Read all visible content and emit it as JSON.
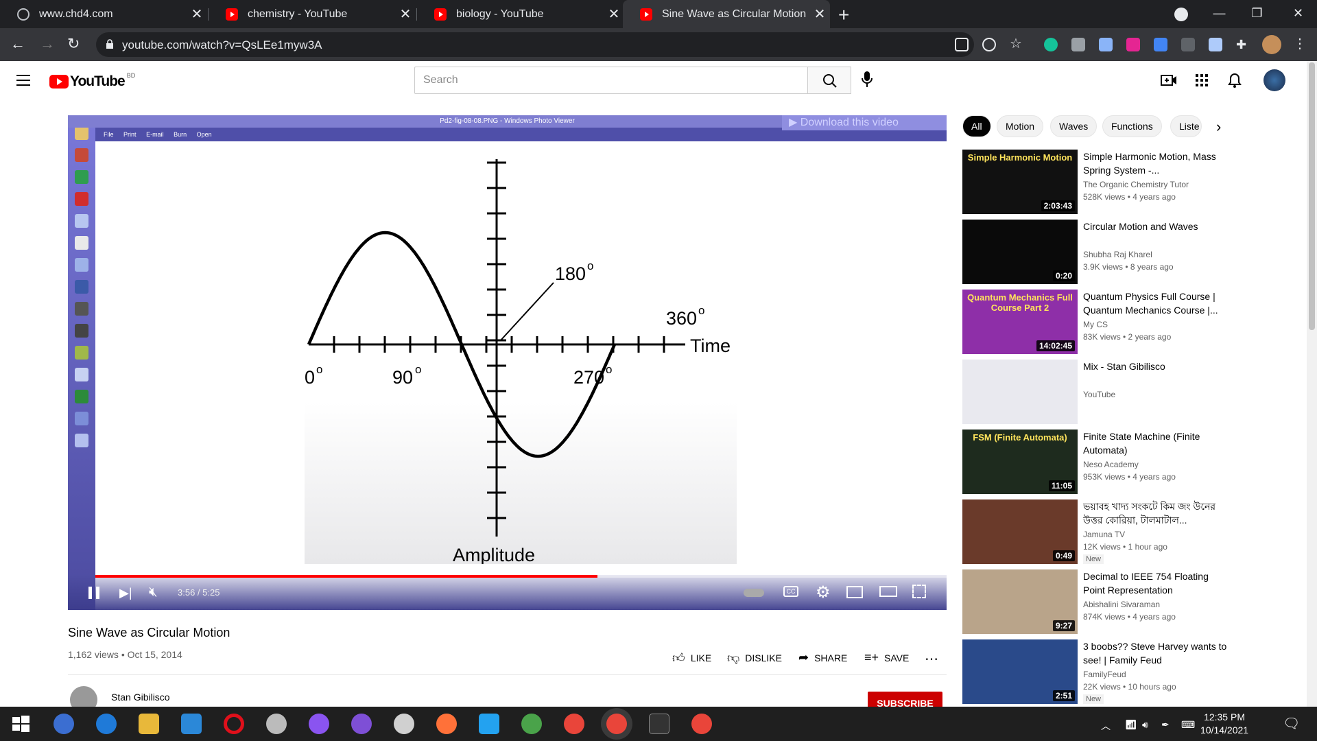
{
  "browser": {
    "tabs": [
      {
        "title": "www.chd4.com"
      },
      {
        "title": "chemistry - YouTube"
      },
      {
        "title": "biology - YouTube"
      },
      {
        "title": "Sine Wave as Circular Motion - Yo"
      }
    ],
    "url": "youtube.com/watch?v=QsLEe1myw3A"
  },
  "youtube": {
    "country": "BD",
    "search_placeholder": "Search"
  },
  "player": {
    "photo_viewer_title": "Pd2-fig-08-08.PNG - Windows Photo Viewer",
    "menu": [
      "File",
      "Print",
      "E-mail",
      "Burn",
      "Open"
    ],
    "download_banner": "Download this video",
    "time": "3:56 / 5:25",
    "progress": 0.59,
    "figure": {
      "labels": {
        "deg0": "0",
        "deg90": "90",
        "deg180": "180",
        "deg270": "270",
        "deg360": "360",
        "deg_sup": "o",
        "time": "Time",
        "amplitude": "Amplitude"
      }
    }
  },
  "video": {
    "title": "Sine Wave as Circular Motion",
    "meta": "1,162 views • Oct 15, 2014",
    "like": "LIKE",
    "dislike": "DISLIKE",
    "share": "SHARE",
    "save": "SAVE",
    "channel": "Stan Gibilisco",
    "subscribe": "SUBSCRIBE"
  },
  "chips": [
    "All",
    "Motion",
    "Waves",
    "Functions",
    "Liste"
  ],
  "recommendations": [
    {
      "title": "Simple Harmonic Motion, Mass Spring System -...",
      "channel": "The Organic Chemistry Tutor",
      "views": "528K views • 4 years ago",
      "duration": "2:03:43",
      "thumb_text": "Simple Harmonic Motion",
      "thumb_bg": "#111111"
    },
    {
      "title": "Circular Motion and Waves",
      "channel": "Shubha Raj Kharel",
      "views": "3.9K views • 8 years ago",
      "duration": "0:20",
      "thumb_text": "",
      "thumb_bg": "#0a0a0a"
    },
    {
      "title": "Quantum Physics Full Course | Quantum Mechanics Course |...",
      "channel": "My CS",
      "views": "83K views • 2 years ago",
      "duration": "14:02:45",
      "thumb_text": "Quantum Mechanics Full Course Part 2",
      "thumb_bg": "#8e2fa8"
    },
    {
      "title": "Mix - Stan Gibilisco",
      "channel": "YouTube",
      "views": "",
      "duration": "",
      "thumb_text": "",
      "thumb_bg": "#e9e9ef"
    },
    {
      "title": "Finite State Machine (Finite Automata)",
      "channel": "Neso Academy",
      "views": "953K views • 4 years ago",
      "duration": "11:05",
      "thumb_text": "FSM (Finite Automata)",
      "thumb_bg": "#1e2b1e"
    },
    {
      "title": "ভয়াবহ খাদ্য সংকটে কিম জং উনের উত্তর কোরিয়া, টালমাটাল...",
      "channel": "Jamuna TV",
      "views": "12K views • 1 hour ago",
      "duration": "0:49",
      "thumb_text": "",
      "thumb_bg": "#6a3a2a",
      "badge": "New"
    },
    {
      "title": "Decimal to IEEE 754 Floating Point Representation",
      "channel": "Abishalini Sivaraman",
      "views": "874K views • 4 years ago",
      "duration": "9:27",
      "thumb_text": "",
      "thumb_bg": "#b9a48a"
    },
    {
      "title": "3 boobs?? Steve Harvey wants to see! | Family Feud",
      "channel": "FamilyFeud",
      "views": "22K views • 10 hours ago",
      "duration": "2:51",
      "thumb_text": "",
      "thumb_bg": "#2a4a8a",
      "badge": "New"
    }
  ],
  "taskbar": {
    "time": "12:35 PM",
    "date": "10/14/2021"
  },
  "colors": {
    "accent": "#ff0000",
    "chrome_dark": "#202124"
  }
}
